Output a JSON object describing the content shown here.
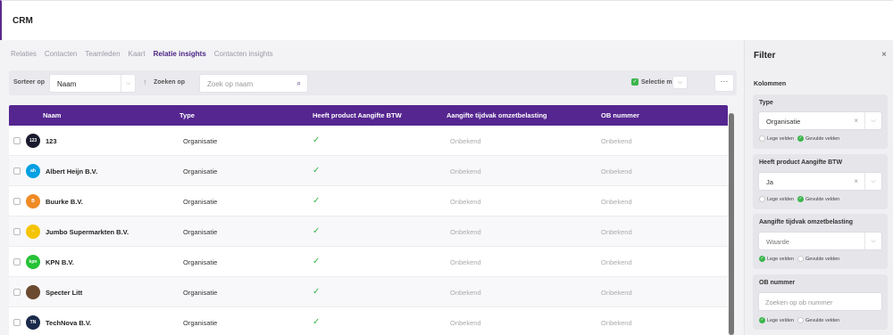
{
  "header": {
    "title": "CRM"
  },
  "tabs": [
    "Relaties",
    "Contacten",
    "Teamleden",
    "Kaart",
    "Relatie insights",
    "Contacten insights"
  ],
  "toolbar": {
    "sort_label": "Sorteer op",
    "sort_value": "Naam",
    "search_label": "Zoeken op",
    "search_placeholder": "Zoek op naam",
    "selection_mode_label": "Selectie modus",
    "more_label": "···"
  },
  "table": {
    "columns": [
      "Naam",
      "Type",
      "Heeft product Aangifte BTW",
      "Aangifte tijdvak omzetbelasting",
      "OB nummer"
    ],
    "rows": [
      {
        "name": "123",
        "type": "Organisatie",
        "btw": "✓",
        "period": "Onbekend",
        "ob": "Onbekend",
        "logo_text": "123",
        "logo_color": "#1a1a2e"
      },
      {
        "name": "Albert Heijn B.V.",
        "type": "Organisatie",
        "btw": "✓",
        "period": "Onbekend",
        "ob": "Onbekend",
        "logo_text": "ah",
        "logo_color": "#00a0e2"
      },
      {
        "name": "Buurke B.V.",
        "type": "Organisatie",
        "btw": "✓",
        "period": "Onbekend",
        "ob": "Onbekend",
        "logo_text": "B",
        "logo_color": "#f08a24"
      },
      {
        "name": "Jumbo Supermarkten B.V.",
        "type": "Organisatie",
        "btw": "✓",
        "period": "Onbekend",
        "ob": "Onbekend",
        "logo_text": "~",
        "logo_color": "#f5c400"
      },
      {
        "name": "KPN B.V.",
        "type": "Organisatie",
        "btw": "✓",
        "period": "Onbekend",
        "ob": "Onbekend",
        "logo_text": "kpn",
        "logo_color": "#25c235"
      },
      {
        "name": "Specter Litt",
        "type": "Organisatie",
        "btw": "✓",
        "period": "Onbekend",
        "ob": "Onbekend",
        "logo_text": "",
        "logo_color": "#6b4a2f"
      },
      {
        "name": "TechNova B.V.",
        "type": "Organisatie",
        "btw": "✓",
        "period": "Onbekend",
        "ob": "Onbekend",
        "logo_text": "TN",
        "logo_color": "#1b2a4a"
      }
    ]
  },
  "filter": {
    "title": "Filter",
    "close": "×",
    "section": "Kolommen",
    "blocks": [
      {
        "label": "Type",
        "value": "Organisatie",
        "opt1": "Lege velden",
        "opt2": "Gevulde velden"
      },
      {
        "label": "Heeft product Aangifte BTW",
        "value": "Ja",
        "opt1": "Lege velden",
        "opt2": "Gevulde velden"
      },
      {
        "label": "Aangifte tijdvak omzetbelasting",
        "value": "Waarde",
        "opt1": "Lege velden",
        "opt2": "Gevulde velden"
      },
      {
        "label": "OB nummer",
        "placeholder": "Zoeken op ob nummer",
        "opt1": "Lege velden",
        "opt2": "Gevulde velden"
      }
    ]
  },
  "colors": {
    "primary": "#55268f",
    "accent": "#3bb54a"
  }
}
